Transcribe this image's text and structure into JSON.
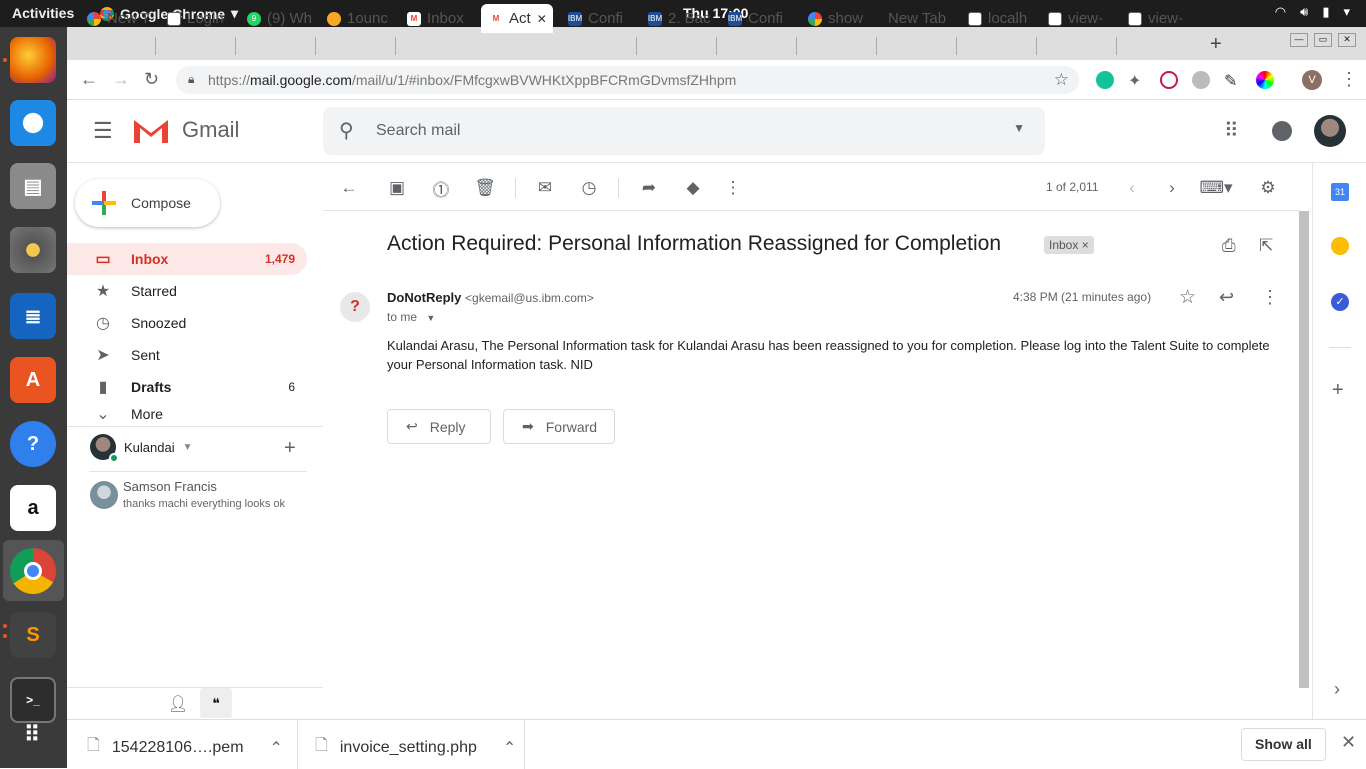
{
  "system": {
    "activities": "Activities",
    "app_name": "Google Chrome",
    "clock": "Thu 17:00"
  },
  "tabs": [
    {
      "label": "New T",
      "icon": "google-icon"
    },
    {
      "label": "Login",
      "icon": "page-icon"
    },
    {
      "label": "(9) Wh",
      "icon": "whatsapp-icon"
    },
    {
      "label": "1ounc",
      "icon": "ounce-icon"
    },
    {
      "label": "Inbox",
      "icon": "gmail-icon"
    },
    {
      "label": "Act",
      "icon": "gmail-icon"
    },
    {
      "label": "Confi",
      "icon": "ibm-icon"
    },
    {
      "label": "2. Bac",
      "icon": "ibm-icon"
    },
    {
      "label": "Confi",
      "icon": "ibm-icon"
    },
    {
      "label": "show",
      "icon": "google-icon"
    },
    {
      "label": "New Tab",
      "icon": ""
    },
    {
      "label": "localh",
      "icon": "page-icon"
    },
    {
      "label": "view-",
      "icon": "page-icon"
    },
    {
      "label": "view-",
      "icon": "page-icon"
    }
  ],
  "address_bar": {
    "scheme": "https://",
    "host": "mail.google.com",
    "path": "/mail/u/1/#inbox/FMfcgxwBVWHKtXppBFCRmGDvmsfZHhpm"
  },
  "gmail": {
    "logo_text": "Gmail",
    "search_placeholder": "Search mail",
    "compose_label": "Compose",
    "nav": [
      {
        "label": "Inbox",
        "count": "1,479",
        "icon": "inbox-icon"
      },
      {
        "label": "Starred",
        "count": "",
        "icon": "star-icon"
      },
      {
        "label": "Snoozed",
        "count": "",
        "icon": "clock-icon"
      },
      {
        "label": "Sent",
        "count": "",
        "icon": "send-icon"
      },
      {
        "label": "Drafts",
        "count": "6",
        "icon": "draft-icon"
      },
      {
        "label": "More",
        "count": "",
        "icon": "chevron-down-icon"
      }
    ],
    "hangouts": {
      "user": "Kulandai",
      "contact_name": "Samson Francis",
      "contact_message": "thanks machi everything looks ok"
    },
    "pager": "1 of 2,011",
    "message": {
      "subject": "Action Required: Personal Information Reassigned for Completion",
      "label": "Inbox",
      "sender_name": "DoNotReply",
      "sender_email": "<gkemail@us.ibm.com>",
      "time": "4:38 PM (21 minutes ago)",
      "to": "to me",
      "body": "Kulandai Arasu, The Personal Information task for Kulandai Arasu has been reassigned to you for completion. Please log into the Talent Suite to complete your Personal Information task. NID",
      "reply_label": "Reply",
      "forward_label": "Forward"
    }
  },
  "downloads": {
    "items": [
      "154228106….pem",
      "invoice_setting.php"
    ],
    "show_all": "Show all"
  }
}
